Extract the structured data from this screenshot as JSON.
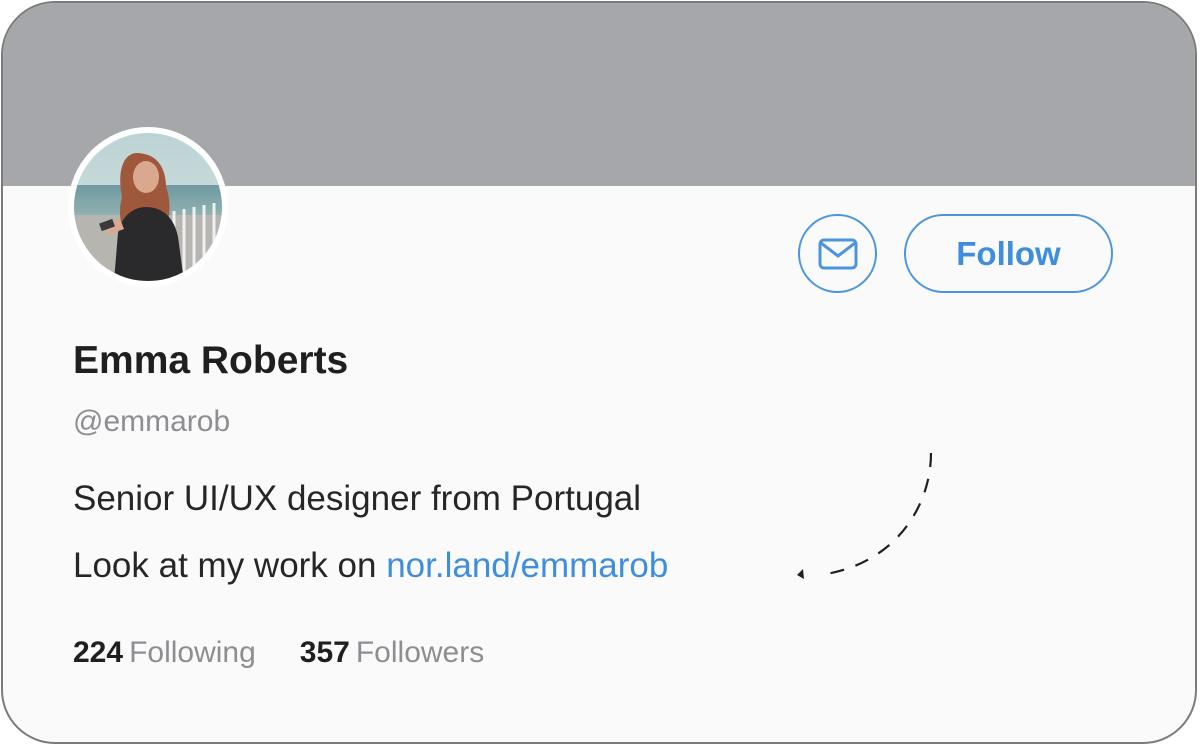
{
  "profile": {
    "name": "Emma Roberts",
    "handle": "@emmarob",
    "bio_line1": "Senior UI/UX designer from Portugal",
    "bio_line2_prefix": "Look at my work on ",
    "bio_link": "nor.land/emmarob"
  },
  "actions": {
    "message_icon": "envelope-icon",
    "follow_label": "Follow"
  },
  "stats": {
    "following_count": "224",
    "following_label": "Following",
    "followers_count": "357",
    "followers_label": "Followers"
  },
  "colors": {
    "accent": "#3f8ede",
    "banner": "#a6a7ab",
    "card_background": "#fafafa"
  }
}
